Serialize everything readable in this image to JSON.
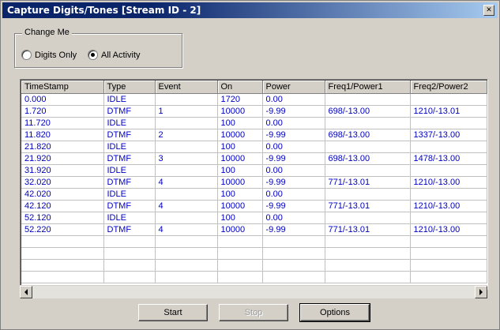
{
  "window": {
    "title": "Capture Digits/Tones [Stream ID - 2]"
  },
  "group": {
    "legend": "Change Me",
    "options": [
      {
        "label": "Digits Only",
        "checked": false
      },
      {
        "label": "All Activity",
        "checked": true
      }
    ]
  },
  "table": {
    "columns": [
      "TimeStamp",
      "Type",
      "Event",
      "On",
      "Power",
      "Freq1/Power1",
      "Freq2/Power2"
    ],
    "rows": [
      [
        "0.000",
        "IDLE",
        "",
        "1720",
        "0.00",
        "",
        ""
      ],
      [
        "1.720",
        "DTMF",
        "1",
        "10000",
        "-9.99",
        "698/-13.00",
        "1210/-13.01"
      ],
      [
        "11.720",
        "IDLE",
        "",
        "100",
        "0.00",
        "",
        ""
      ],
      [
        "11.820",
        "DTMF",
        "2",
        "10000",
        "-9.99",
        "698/-13.00",
        "1337/-13.00"
      ],
      [
        "21.820",
        "IDLE",
        "",
        "100",
        "0.00",
        "",
        ""
      ],
      [
        "21.920",
        "DTMF",
        "3",
        "10000",
        "-9.99",
        "698/-13.00",
        "1478/-13.00"
      ],
      [
        "31.920",
        "IDLE",
        "",
        "100",
        "0.00",
        "",
        ""
      ],
      [
        "32.020",
        "DTMF",
        "4",
        "10000",
        "-9.99",
        "771/-13.01",
        "1210/-13.00"
      ],
      [
        "42.020",
        "IDLE",
        "",
        "100",
        "0.00",
        "",
        ""
      ],
      [
        "42.120",
        "DTMF",
        "4",
        "10000",
        "-9.99",
        "771/-13.01",
        "1210/-13.00"
      ],
      [
        "52.120",
        "IDLE",
        "",
        "100",
        "0.00",
        "",
        ""
      ],
      [
        "52.220",
        "DTMF",
        "4",
        "10000",
        "-9.99",
        "771/-13.01",
        "1210/-13.00"
      ]
    ],
    "empty_rows": 4
  },
  "buttons": {
    "start": "Start",
    "stop": "Stop",
    "options": "Options"
  },
  "icons": {
    "close": "close-icon",
    "scroll_left": "arrow-left-icon",
    "scroll_right": "arrow-right-icon"
  },
  "colors": {
    "cell_text": "#0000c0",
    "titlebar": "#0a246a"
  }
}
